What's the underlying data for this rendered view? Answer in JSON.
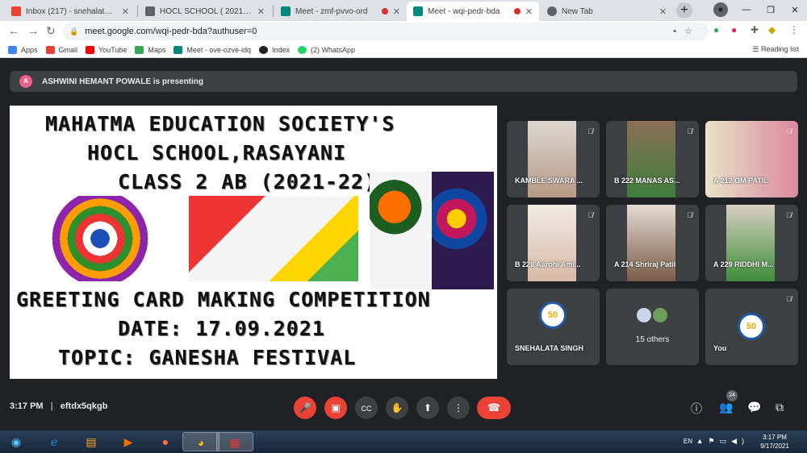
{
  "browser": {
    "tabs": [
      {
        "title": "Inbox (217) - snehalatasingh@",
        "favicon_color": "#ea4335"
      },
      {
        "title": "HOCL SCHOOL ( 2021- 22) CL",
        "favicon_color": "#5f6368"
      },
      {
        "title": "Meet - zmf-pvvo-ord",
        "favicon_color": "#00897b"
      },
      {
        "title": "Meet - wqi-pedr-bda",
        "favicon_color": "#00897b"
      },
      {
        "title": "New Tab",
        "favicon_color": "#5f6368"
      }
    ],
    "url": "meet.google.com/wqi-pedr-bda?authuser=0",
    "bookmarks": [
      {
        "label": "Apps",
        "color": "#4285f4"
      },
      {
        "label": "Gmail",
        "color": "#ea4335"
      },
      {
        "label": "YouTube",
        "color": "#ff0000"
      },
      {
        "label": "Maps",
        "color": "#34a853"
      },
      {
        "label": "Meet - ove-ozve-idq",
        "color": "#00897b"
      },
      {
        "label": "Index",
        "color": "#202124"
      },
      {
        "label": "(2) WhatsApp",
        "color": "#25d366"
      }
    ],
    "reading_list": "Reading list"
  },
  "meet": {
    "presenter_initial": "A",
    "presenter_text": "ASHWINI HEMANT POWALE is presenting",
    "slide": {
      "line1": "MAHATMA EDUCATION SOCIETY'S",
      "line2": "HOCL SCHOOL,RASAYANI",
      "line3": "CLASS 2 AB (2021-22)",
      "line4": "GREETING CARD MAKING COMPETITION",
      "line5": "DATE: 17.09.2021",
      "line6": "TOPIC: GANESHA FESTIVAL"
    },
    "participants": [
      {
        "name": "KAMBLE SWARA ..."
      },
      {
        "name": "B 222 MANAS AS..."
      },
      {
        "name": "A 212 OM PATIL"
      },
      {
        "name": "B 228 Aarohi Ami..."
      },
      {
        "name": "A 214 Shriraj Patil"
      },
      {
        "name": "A 229 RIDDHI M..."
      },
      {
        "name": "SNEHALATA SINGH"
      },
      {
        "name": "15 others"
      },
      {
        "name": "You"
      }
    ],
    "logo_text": "50",
    "time": "3:17 PM",
    "meeting_code": "eftdx5qkgb",
    "participant_count": "24"
  },
  "taskbar": {
    "lang": "EN",
    "time": "3:17 PM",
    "date": "9/17/2021"
  }
}
